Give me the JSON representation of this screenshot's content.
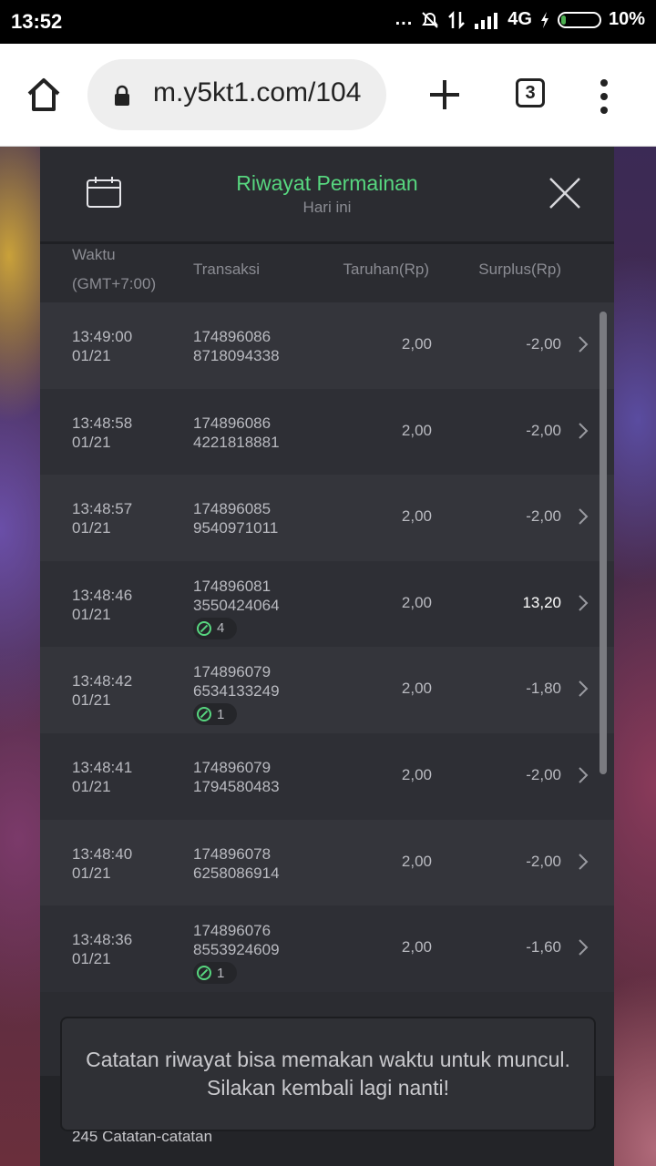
{
  "status_bar": {
    "time": "13:52",
    "network": "4G",
    "battery": "10%",
    "dots": "..."
  },
  "browser": {
    "url": "m.y5kt1.com/104",
    "tab_count": "3",
    "icons": [
      "home-icon",
      "lock-icon",
      "plus-icon",
      "tabs-icon",
      "menu-icon"
    ]
  },
  "modal": {
    "title": "Riwayat Permainan",
    "subtitle": "Hari ini",
    "title_color": "#57d67f",
    "columns": {
      "time_line1": "Waktu",
      "time_line2": "(GMT+7:00)",
      "transaction": "Transaksi",
      "bet": "Taruhan(Rp)",
      "surplus": "Surplus(Rp)"
    },
    "rows": [
      {
        "time": "13:49:00",
        "date": "01/21",
        "tx1": "174896086",
        "tx2": "8718094338",
        "badge": "",
        "bet": "2,00",
        "surplus": "-2,00"
      },
      {
        "time": "13:48:58",
        "date": "01/21",
        "tx1": "174896086",
        "tx2": "4221818881",
        "badge": "",
        "bet": "2,00",
        "surplus": "-2,00"
      },
      {
        "time": "13:48:57",
        "date": "01/21",
        "tx1": "174896085",
        "tx2": "9540971011",
        "badge": "",
        "bet": "2,00",
        "surplus": "-2,00"
      },
      {
        "time": "13:48:46",
        "date": "01/21",
        "tx1": "174896081",
        "tx2": "3550424064",
        "badge": "4",
        "bet": "2,00",
        "surplus": "13,20"
      },
      {
        "time": "13:48:42",
        "date": "01/21",
        "tx1": "174896079",
        "tx2": "6534133249",
        "badge": "1",
        "bet": "2,00",
        "surplus": "-1,80"
      },
      {
        "time": "13:48:41",
        "date": "01/21",
        "tx1": "174896079",
        "tx2": "1794580483",
        "badge": "",
        "bet": "2,00",
        "surplus": "-2,00"
      },
      {
        "time": "13:48:40",
        "date": "01/21",
        "tx1": "174896078",
        "tx2": "6258086914",
        "badge": "",
        "bet": "2,00",
        "surplus": "-2,00"
      },
      {
        "time": "13:48:36",
        "date": "01/21",
        "tx1": "174896076",
        "tx2": "8553924609",
        "badge": "1",
        "bet": "2,00",
        "surplus": "-1,60"
      }
    ],
    "footer_count": "245 Catatan-catatan",
    "toast": "Catatan riwayat bisa memakan waktu untuk muncul. Silakan kembali lagi nanti!"
  }
}
